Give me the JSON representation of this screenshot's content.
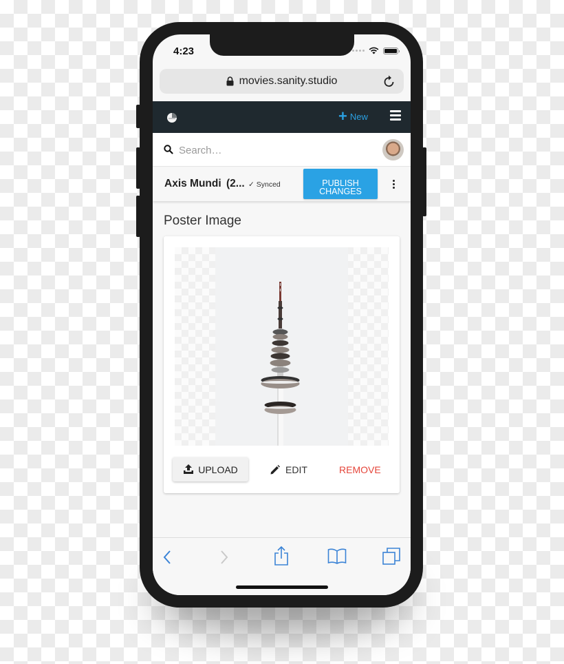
{
  "status_bar": {
    "time": "4:23",
    "icons": [
      "signal-dots-icon",
      "wifi-icon",
      "battery-icon"
    ]
  },
  "browser": {
    "url": "movies.sanity.studio",
    "lock_icon": "lock-icon",
    "reload_icon": "reload-icon"
  },
  "app_nav": {
    "logo_icon": "sanity-logo-icon",
    "new_label": "New",
    "new_icon": "plus-icon",
    "menu_icon": "hamburger-menu-icon"
  },
  "search": {
    "placeholder": "Search…",
    "value": ""
  },
  "document": {
    "title": "Axis Mundi",
    "year_truncated": "(2...",
    "sync_status": "Synced",
    "publish_label_line1": "PUBLISH",
    "publish_label_line2": "CHANGES"
  },
  "field": {
    "label": "Poster Image",
    "actions": {
      "upload": "UPLOAD",
      "edit": "EDIT",
      "remove": "REMOVE"
    }
  },
  "browser_toolbar": {
    "back": "back-icon",
    "forward": "forward-icon",
    "share": "share-icon",
    "bookmarks": "bookmarks-icon",
    "tabs": "tabs-icon"
  },
  "colors": {
    "accent": "#2aa2e4",
    "nav_bg": "#1f292f",
    "danger": "#e5453a",
    "ios_blue": "#3a83d6"
  }
}
